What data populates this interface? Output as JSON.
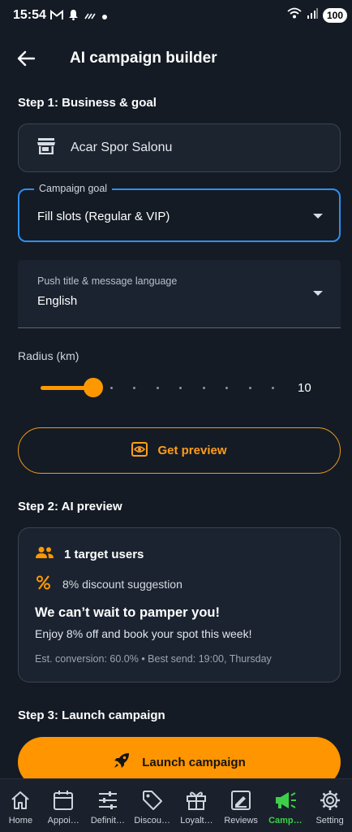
{
  "status_bar": {
    "time": "15:54",
    "battery": "100"
  },
  "header": {
    "title": "AI campaign builder"
  },
  "step1": {
    "label": "Step 1: Business & goal",
    "business_name": "Acar Spor Salonu",
    "goal_caption": "Campaign goal",
    "goal_value": "Fill slots (Regular & VIP)",
    "language_caption": "Push title & message language",
    "language_value": "English",
    "radius_label": "Radius (km)",
    "radius_value": "10",
    "radius_min": 0,
    "radius_max": 50,
    "preview_button": "Get preview"
  },
  "step2": {
    "label": "Step 2: AI preview",
    "target_users": "1 target users",
    "discount": "8% discount suggestion",
    "headline": "We can’t wait to pamper you!",
    "body": "Enjoy 8% off and book your spot this week!",
    "meta": "Est. conversion: 60.0% • Best send: 19:00, Thursday"
  },
  "step3": {
    "label": "Step 3: Launch campaign",
    "launch_button": "Launch campaign"
  },
  "nav": {
    "items": [
      {
        "label": "Home",
        "icon": "home-icon"
      },
      {
        "label": "Appoi…",
        "icon": "calendar-icon"
      },
      {
        "label": "Definit…",
        "icon": "sliders-icon"
      },
      {
        "label": "Discou…",
        "icon": "tag-icon"
      },
      {
        "label": "Loyalt…",
        "icon": "gift-icon"
      },
      {
        "label": "Reviews",
        "icon": "review-icon"
      },
      {
        "label": "Camp…",
        "icon": "megaphone-icon"
      },
      {
        "label": "Setting",
        "icon": "gear-icon"
      }
    ],
    "active_index": 6
  },
  "colors": {
    "accent": "#ff9800",
    "focus": "#2f8ef0",
    "active_nav": "#3ecf4a",
    "background": "#141b25"
  }
}
